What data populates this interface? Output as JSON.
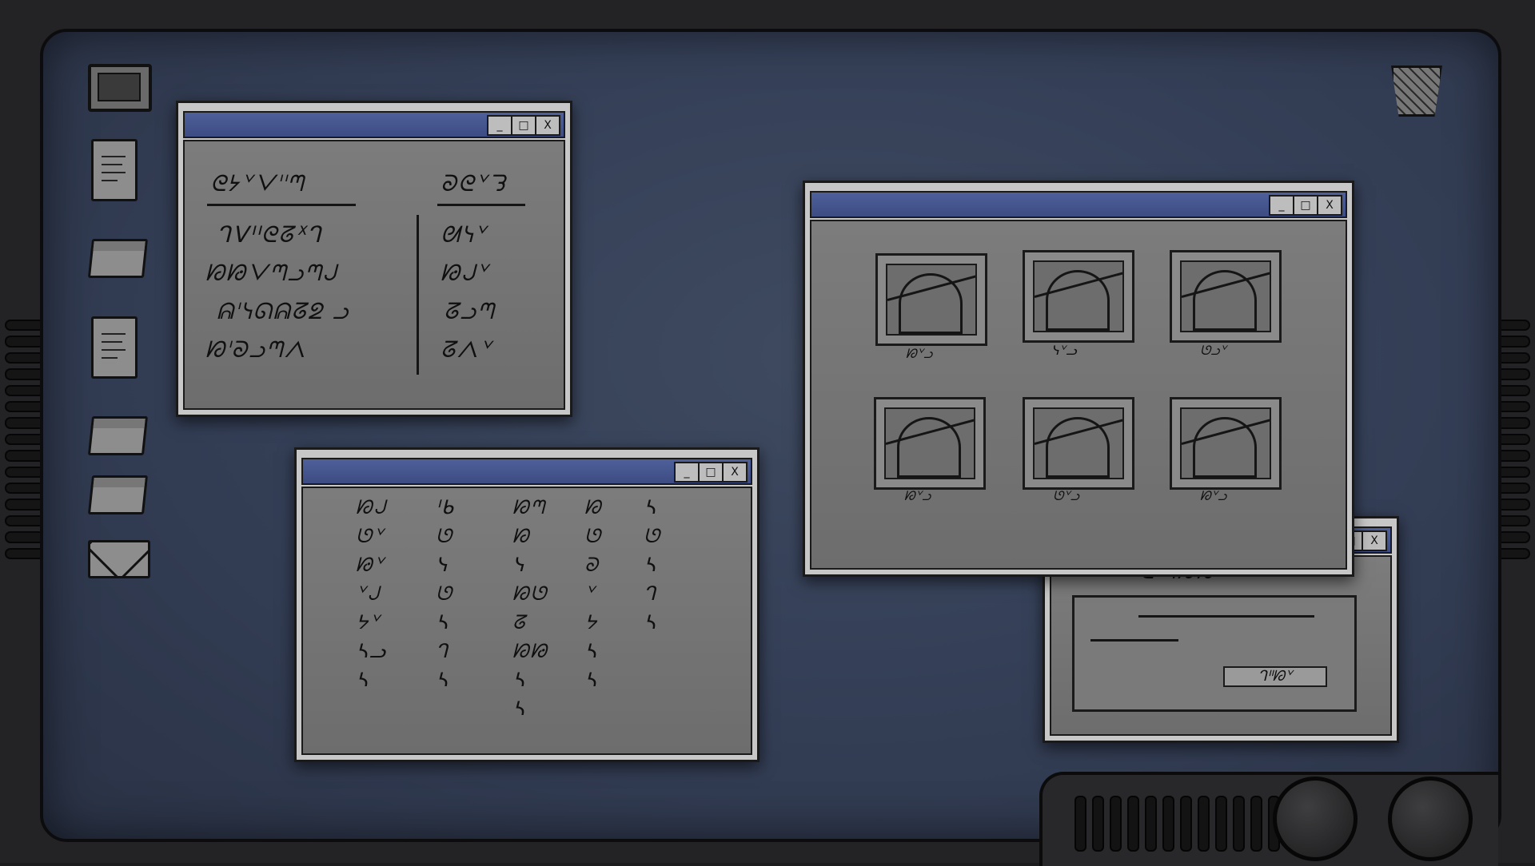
{
  "desktop": {
    "icons": [
      {
        "name": "computer-icon",
        "kind": "pc"
      },
      {
        "name": "document-icon",
        "kind": "doc"
      },
      {
        "name": "folder-icon",
        "kind": "folder"
      },
      {
        "name": "document-icon",
        "kind": "doc"
      },
      {
        "name": "folder-icon",
        "kind": "folder"
      },
      {
        "name": "folder-icon",
        "kind": "folder"
      },
      {
        "name": "mail-icon",
        "kind": "mail"
      }
    ],
    "trash_icon": "trash-icon"
  },
  "window_controls": {
    "minimize": "_",
    "maximize": "□",
    "close": "X"
  },
  "notes_window": {
    "col1_heading": "ᘓᔭᘁᐯᑊᑊᘉ",
    "col2_heading": "ᘐᘓᘁᘊ",
    "col1_rows": [
      "ᒉᐯᑊᑊᘓᘔᕽᒉ",
      "ᘗᘙᐯᘉᓗᘉᒍ",
      "ᕱᑊᓭᘏᕱᘔᘖ ᓗ",
      "ᘗᑊᘐᓗᘉᐱ"
    ],
    "col2_rows": [
      "ᘛᓭᘁ",
      "ᘙᒍᘁ",
      "ᘔᓗᘉ",
      "ᘔᐱᘁ"
    ]
  },
  "glyph_window": {
    "columns": [
      [
        "ᘗᒍ",
        "ᘎᘁ",
        "ᘙᘁ",
        "ᘁᒍ",
        "ᔭᘁ",
        "ᓴᓗ",
        "ᓴ"
      ],
      [
        "ᑊᑲ",
        "ᘎ",
        "ᓭ",
        "ᘎ",
        "ᓴ",
        "ᒉ",
        "ᓴ"
      ],
      [
        "ᘗᘉ",
        "ᘗ",
        "ᓭ",
        "ᘗᘎ",
        "ᘔ",
        "ᘗᘙ",
        "ᓴ",
        "ᓴ"
      ],
      [
        "ᘗ",
        "ᘎ",
        "ᘐ",
        "ᘁ",
        "ᔭ",
        "ᓴ",
        "ᓴ"
      ],
      [
        "ᓴ",
        "ᘎ",
        "ᓴ",
        "ᒉ",
        "ᓴ"
      ]
    ]
  },
  "gallery_window": {
    "labels": [
      "ᘗᘁᓗ",
      "ᓭᘁᓗ",
      "ᘎᓗᘁ",
      "ᘗᘁᓗ",
      "ᘎᘁᓗ",
      "ᘗᘁᓗ"
    ]
  },
  "dialog_window": {
    "title_text": "ᘓᑊᘉᘗᘙ",
    "button_label": "ᒉᑊᑊᘗᘁ"
  }
}
